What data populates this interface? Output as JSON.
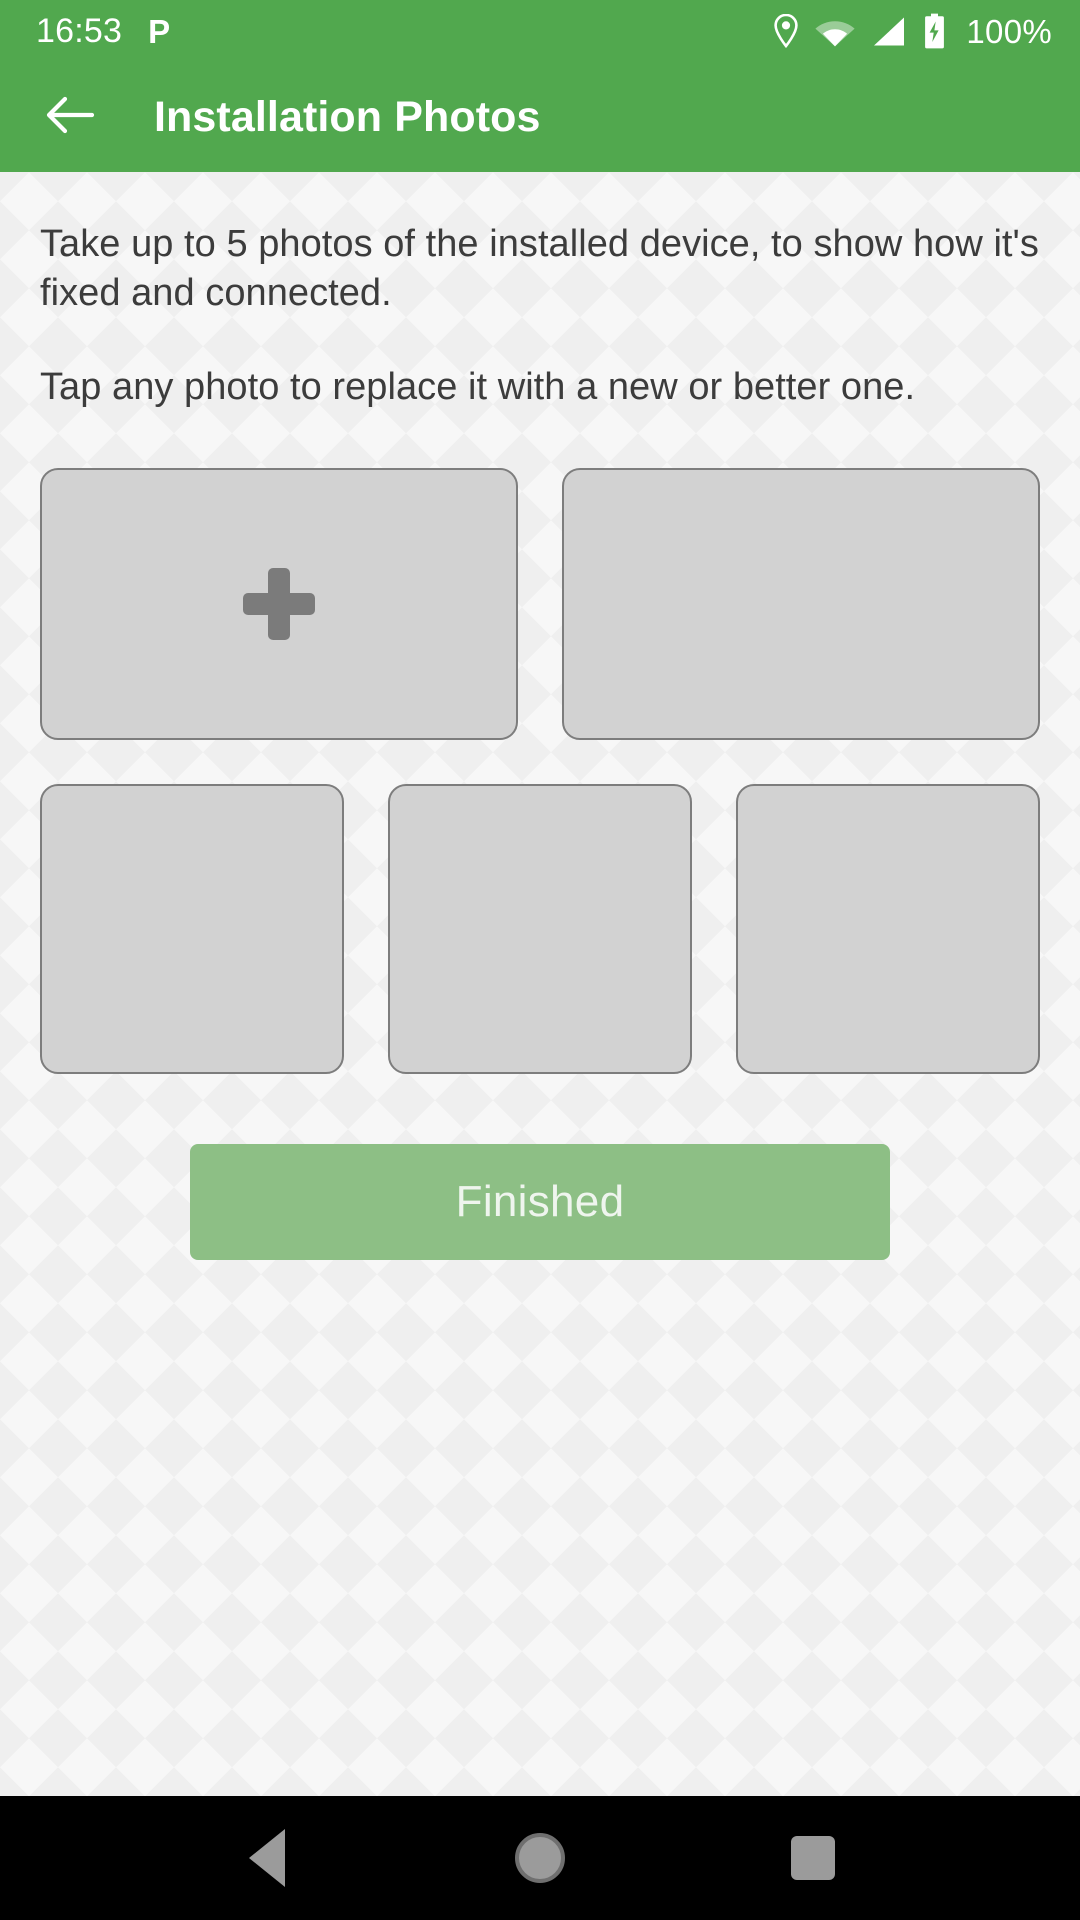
{
  "status_bar": {
    "time": "16:53",
    "notification_icon": "P",
    "icons": [
      "location-pin-icon",
      "wifi-icon",
      "cellular-signal-icon",
      "battery-charging-icon"
    ],
    "battery_percent": "100%",
    "background_color": "#51a84e",
    "foreground_color": "#ffffff"
  },
  "app_bar": {
    "back_icon": "back-arrow-icon",
    "title": "Installation Photos",
    "background_color": "#51a84e",
    "title_color": "#ffffff"
  },
  "content": {
    "paragraph_1": "Take up to 5 photos of the installed device, to show how it's fixed and connected.",
    "paragraph_2": "Tap any photo to replace it with a new or better one.",
    "background_color": "#f7f7f7",
    "text_color": "#3c3c3c"
  },
  "photo_grid": {
    "max_photos": 5,
    "tile_fill_color": "#d2d2d2",
    "tile_border_color": "#7d7d7d",
    "plus_icon_color": "#7b7b7b",
    "rows": [
      {
        "tiles": [
          {
            "slot": 1,
            "icon": "plus-icon",
            "has_photo": false,
            "filled": false
          },
          {
            "slot": 2,
            "icon": "",
            "has_photo": false,
            "filled": false
          }
        ]
      },
      {
        "tiles": [
          {
            "slot": 3,
            "icon": "",
            "has_photo": false,
            "filled": false
          },
          {
            "slot": 4,
            "icon": "",
            "has_photo": false,
            "filled": false
          },
          {
            "slot": 5,
            "icon": "",
            "has_photo": false,
            "filled": false
          }
        ]
      }
    ]
  },
  "finished_button": {
    "label": "Finished",
    "enabled": false,
    "background_color": "#8dbf85",
    "text_color": "#eff5ee"
  },
  "nav_bar": {
    "background_color": "#000000",
    "icon_color": "#9b9b9b",
    "buttons": [
      {
        "name": "back",
        "icon": "triangle-back-icon"
      },
      {
        "name": "home",
        "icon": "circle-home-icon"
      },
      {
        "name": "recents",
        "icon": "square-recents-icon"
      }
    ]
  }
}
